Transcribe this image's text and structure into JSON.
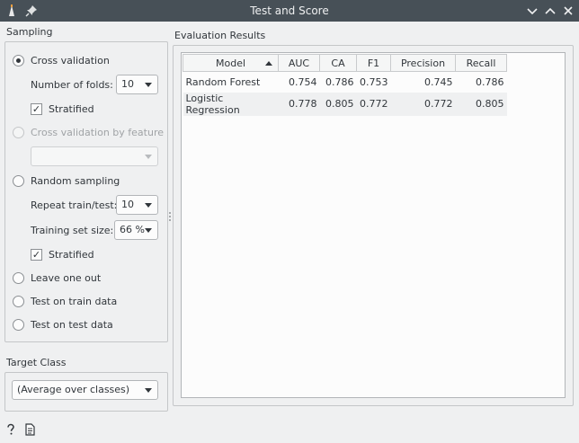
{
  "window": {
    "title": "Test and Score"
  },
  "sampling": {
    "section_label": "Sampling",
    "cross_validation": "Cross validation",
    "folds_label": "Number of folds:",
    "folds_value": "10",
    "stratified_label": "Stratified",
    "cv_by_feature": "Cross validation by feature",
    "feature_value": "",
    "random_sampling": "Random sampling",
    "repeat_label": "Repeat train/test:",
    "repeat_value": "10",
    "train_size_label": "Training set size:",
    "train_size_value": "66 %",
    "stratified2_label": "Stratified",
    "leave_one_out": "Leave one out",
    "test_on_train": "Test on train data",
    "test_on_test": "Test on test data",
    "selected": "Cross validation",
    "stratified_checked": true,
    "stratified2_checked": true
  },
  "target": {
    "section_label": "Target Class",
    "value": "(Average over classes)"
  },
  "results": {
    "section_label": "Evaluation Results",
    "columns": [
      "Model",
      "AUC",
      "CA",
      "F1",
      "Precision",
      "Recall"
    ],
    "sorted_by": "Model",
    "rows": [
      [
        "Random Forest",
        "0.754",
        "0.786",
        "0.753",
        "0.745",
        "0.786"
      ],
      [
        "Logistic Regression",
        "0.778",
        "0.805",
        "0.772",
        "0.772",
        "0.805"
      ]
    ]
  },
  "icons": {
    "app": "orange-app-icon",
    "pin": "pin-icon",
    "minimize": "chevron-down-icon",
    "maximize": "chevron-up-icon",
    "close": "close-icon",
    "help": "help-icon",
    "report": "report-icon"
  },
  "colors": {
    "titlebar": "#475057",
    "window_bg": "#eff0f1",
    "border": "#c4c6c8"
  }
}
